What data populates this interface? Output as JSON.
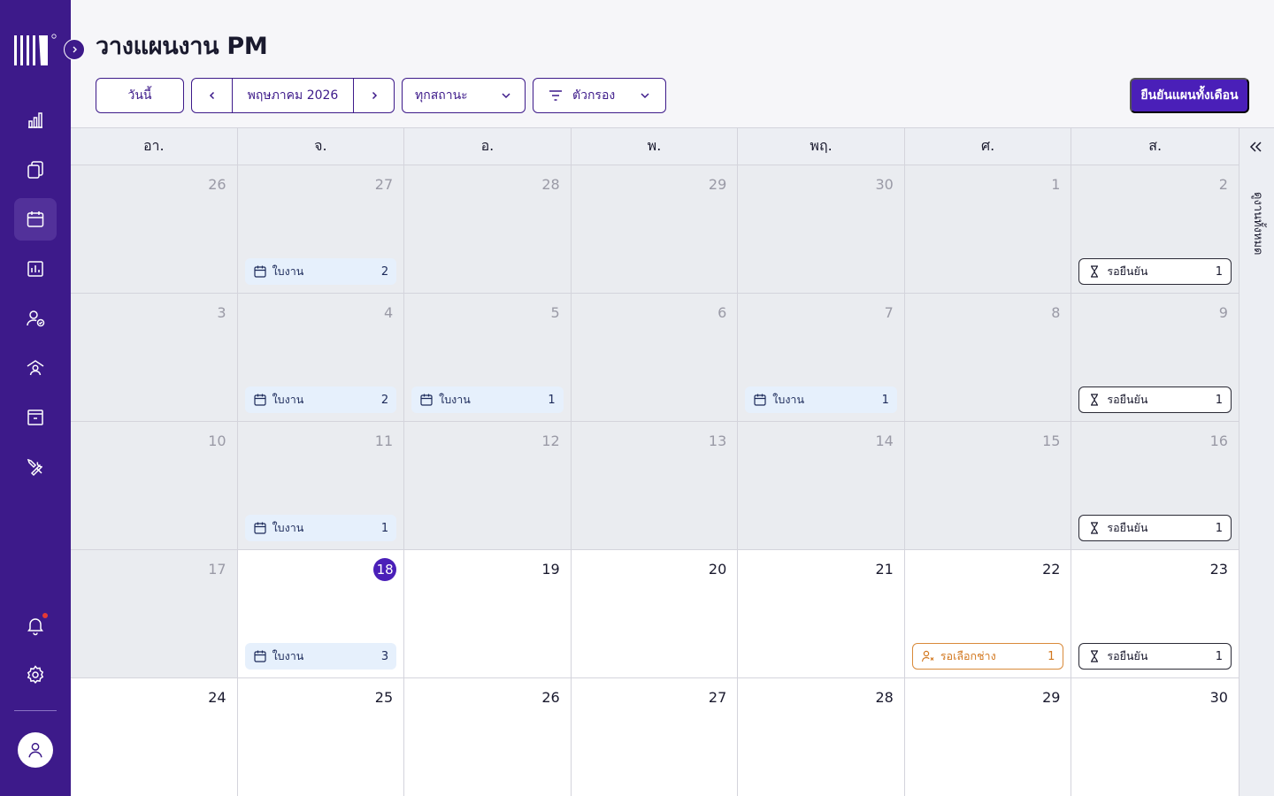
{
  "header": {
    "title": "วางแผนงาน PM"
  },
  "toolbar": {
    "today_label": "วันนี้",
    "month_label": "พฤษภาคม 2026",
    "status_label": "ทุกสถานะ",
    "filter_label": "ตัวกรอง",
    "confirm_label": "ยืนยันแผนทั้งเดือน"
  },
  "calendar": {
    "weekdays": [
      "อา.",
      "จ.",
      "อ.",
      "พ.",
      "พฤ.",
      "ศ.",
      "ส."
    ],
    "days": [
      "26",
      "27",
      "28",
      "29",
      "30",
      "1",
      "2",
      "3",
      "4",
      "5",
      "6",
      "7",
      "8",
      "9",
      "10",
      "11",
      "12",
      "13",
      "14",
      "15",
      "16",
      "17",
      "18",
      "19",
      "20",
      "21",
      "22",
      "23",
      "24",
      "25",
      "26",
      "27",
      "28",
      "29",
      "30"
    ],
    "today_index": 22,
    "events": {
      "workorder_label": "ใบงาน",
      "pending_label": "รอยืนยัน",
      "tech_label": "รอเลือกช่าง",
      "w1_mon_count": "2",
      "w1_sat_count": "1",
      "w2_mon_count": "2",
      "w2_tue_count": "1",
      "w2_thu_count": "1",
      "w2_sat_count": "1",
      "w3_mon_count": "1",
      "w3_sat_count": "1",
      "w4_mon_count": "3",
      "w4_fri_count": "1",
      "w4_sat_count": "1"
    }
  },
  "right_panel": {
    "title": "ดูงานทั้งหมด"
  },
  "sidebar": {
    "items": [
      "dashboard-icon",
      "documents-icon",
      "calendar-icon",
      "report-icon",
      "user-check-icon",
      "home-user-icon",
      "archive-icon",
      "tools-icon"
    ],
    "bottom": [
      "bell-icon",
      "settings-icon",
      "user-avatar-icon"
    ]
  },
  "colors": {
    "sidebar": "#3d1a8a",
    "accent": "#4a1fb8",
    "workorder_bg": "#e6f0fc",
    "tech_orange": "#d2771e"
  }
}
